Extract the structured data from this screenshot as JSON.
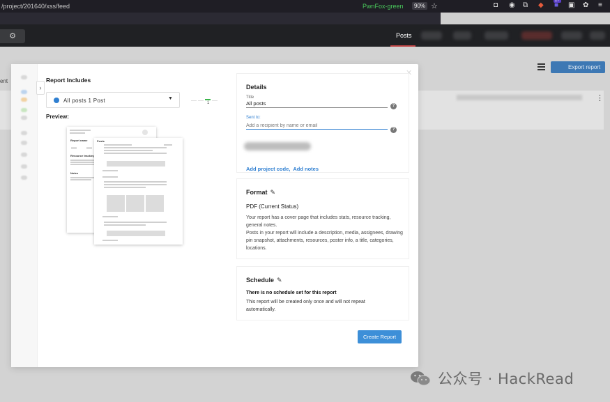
{
  "browser": {
    "url": "/project/201640/xss/feed",
    "container": "PwnFox-green",
    "zoom": "90%",
    "extensions_badge": "27"
  },
  "header": {
    "nav_posts": "Posts"
  },
  "background": {
    "export_label": "Export report",
    "left_partial": "ent"
  },
  "modal": {
    "report_includes_title": "Report Includes",
    "posts_select": "All posts  1 Post",
    "indicator_number": "1",
    "preview_label": "Preview:",
    "preview": {
      "report_name": "Report name",
      "resource_tracking": "Resource tracking",
      "notes": "Notes",
      "posts": "Posts"
    },
    "details": {
      "heading": "Details",
      "title_label": "Title",
      "title_value": "All posts",
      "sent_to_label": "Sent to:",
      "sent_to_placeholder": "Add a recipient by name or email",
      "add_project_code": "Add project code,",
      "add_notes": "Add notes"
    },
    "format": {
      "heading": "Format",
      "type": "PDF (Current Status)",
      "description": "Your report has a cover page that includes stats, resource tracking, general notes.",
      "description2": "Posts in your report will include a description, media, assignees, drawing pin snapshot, attachments, resources, poster info, a title, categories, locations."
    },
    "schedule": {
      "heading": "Schedule",
      "status": "There is no schedule set for this report",
      "description": "This report will be created only once and will not repeat automatically."
    },
    "create_button": "Create Report"
  },
  "watermark": {
    "text": "公众号 · HackRead"
  },
  "colors": {
    "accent_blue": "#2f7fd1",
    "button_blue": "#3d8fd8",
    "nav_underline": "#c04545",
    "container_green": "#49c85b"
  }
}
